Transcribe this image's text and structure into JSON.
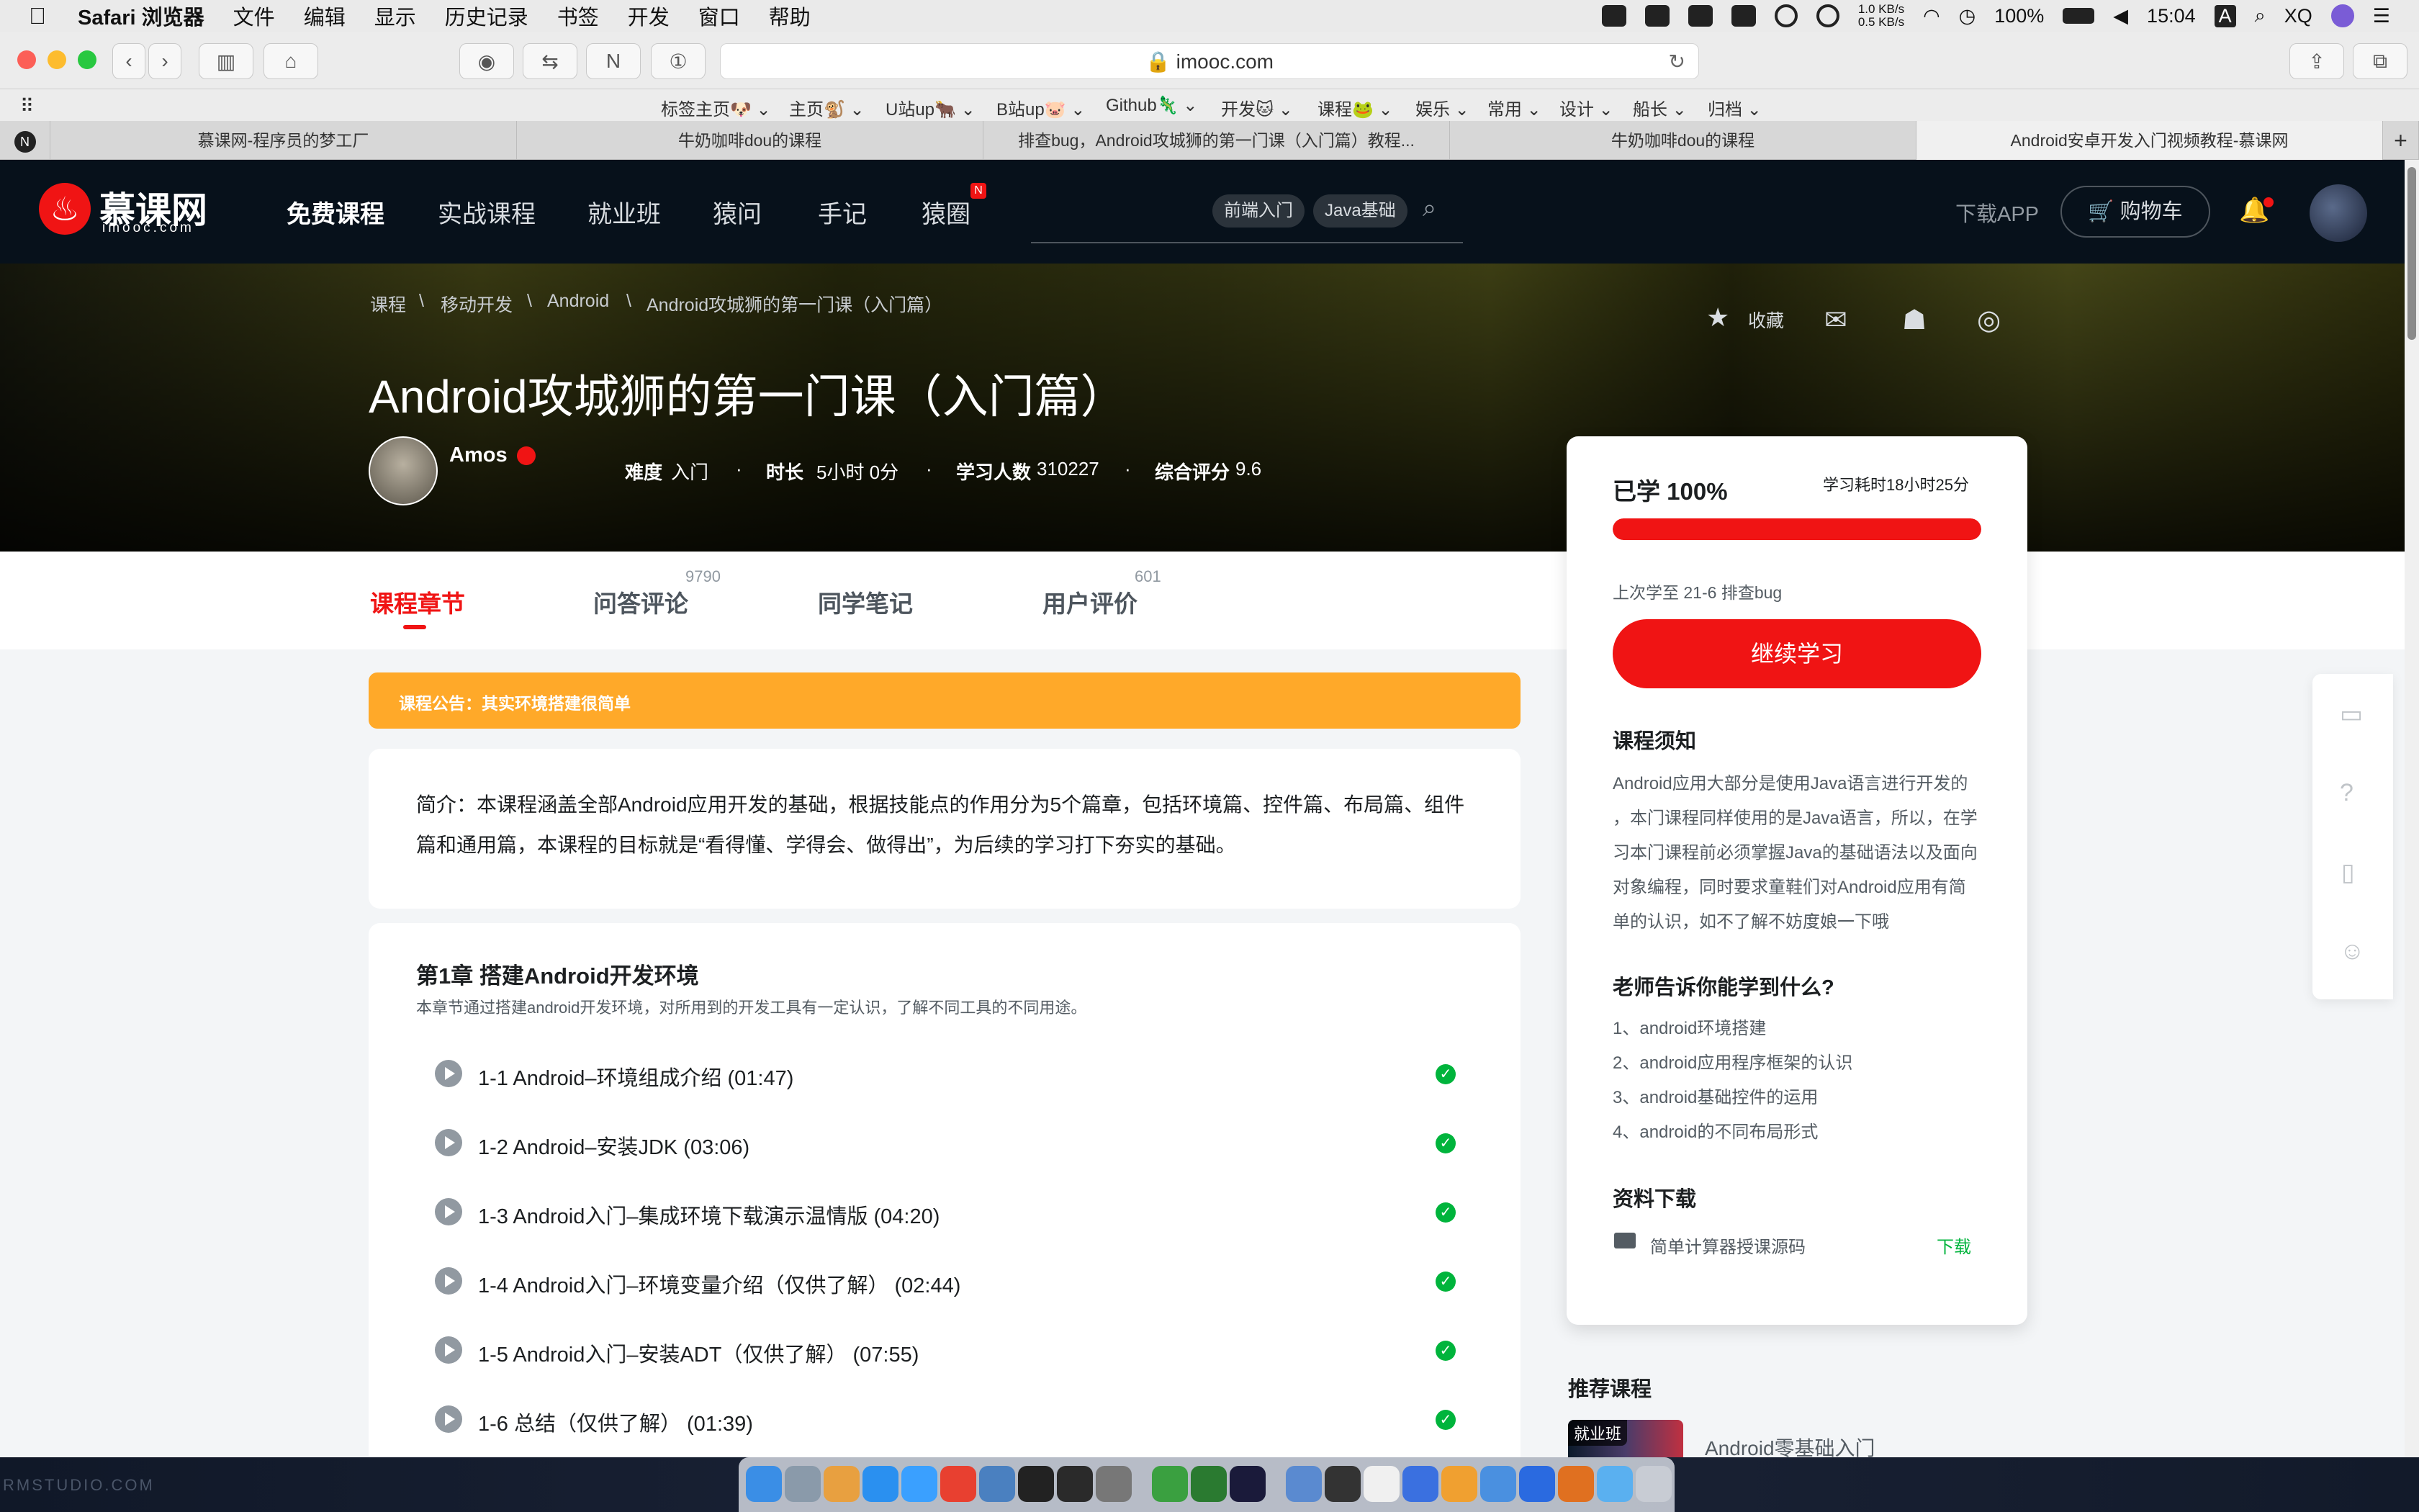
{
  "menubar": {
    "app": "Safari 浏览器",
    "items": [
      "文件",
      "编辑",
      "显示",
      "历史记录",
      "书签",
      "开发",
      "窗口",
      "帮助"
    ],
    "net_up": "1.0 KB/s",
    "net_down": "0.5 KB/s",
    "battery": "100%",
    "time": "15:04",
    "input": "A",
    "user": "XQ"
  },
  "browser": {
    "url": "imooc.com",
    "bookmarks": [
      "标签主页🐶",
      "主页🐒",
      "U站up🐂",
      "B站up🐷",
      "Github🦎",
      "开发🐱",
      "课程🐸",
      "娱乐",
      "常用",
      "设计",
      "船长",
      "归档"
    ],
    "tabs": [
      "慕课网-程序员的梦工厂",
      "牛奶咖啡dou的课程",
      "排查bug，Android攻城狮的第一门课（入门篇）教程...",
      "牛奶咖啡dou的课程",
      "Android安卓开发入门视频教程-慕课网"
    ]
  },
  "header": {
    "logo": "慕课网",
    "logo_sub": "imooc.com",
    "nav": [
      "免费课程",
      "实战课程",
      "就业班",
      "猿问",
      "手记",
      "猿圈"
    ],
    "nav_badge": "N",
    "search_tags": [
      "前端入门",
      "Java基础"
    ],
    "download": "下载APP",
    "cart": "购物车"
  },
  "course": {
    "breadcrumb": [
      "课程",
      "移动开发",
      "Android",
      "Android攻城狮的第一门课（入门篇）"
    ],
    "title": "Android攻城狮的第一门课（入门篇）",
    "teacher": "Amos",
    "meta": {
      "level_label": "难度",
      "level": "入门",
      "duration_label": "时长",
      "duration": "5小时 0分",
      "learners_label": "学习人数",
      "learners": "310227",
      "score_label": "综合评分",
      "score": "9.6"
    },
    "collect": "收藏",
    "tabs": [
      {
        "label": "课程章节"
      },
      {
        "label": "问答评论",
        "count": "9790"
      },
      {
        "label": "同学笔记"
      },
      {
        "label": "用户评价",
        "count": "601"
      }
    ],
    "notice": "课程公告：其实环境搭建很简单",
    "intro": "简介：本课程涵盖全部Android应用开发的基础，根据技能点的作用分为5个篇章，包括环境篇、控件篇、布局篇、组件篇和通用篇，本课程的目标就是“看得懂、学得会、做得出”，为后续的学习打下夯实的基础。",
    "chapter": {
      "title": "第1章 搭建Android开发环境",
      "desc": "本章节通过搭建android开发环境，对所用到的开发工具有一定认识，了解不同工具的不同用途。",
      "items": [
        "1-1 Android–环境组成介绍 (01:47)",
        "1-2 Android–安装JDK (03:06)",
        "1-3 Android入门–集成环境下载演示温情版 (04:20)",
        "1-4 Android入门–环境变量介绍（仅供了解） (02:44)",
        "1-5 Android入门–安装ADT（仅供了解） (07:55)",
        "1-6 总结（仅供了解） (01:39)"
      ]
    }
  },
  "progress": {
    "label": "已学 100%",
    "percent": 100,
    "time_spent": "学习耗时18小时25分",
    "last": "上次学至 21-6 排查bug",
    "continue": "继续学习"
  },
  "notes": {
    "title": "课程须知",
    "lines": [
      "Android应用大部分是使用Java语言进行开发的",
      "，本门课程同样使用的是Java语言，所以，在学",
      "习本门课程前必须掌握Java的基础语法以及面向",
      "对象编程，同时要求童鞋们对Android应用有简",
      "单的认识，如不了解不妨度娘一下哦"
    ]
  },
  "learn": {
    "title": "老师告诉你能学到什么?",
    "items": [
      "1、android环境搭建",
      "2、android应用程序框架的认识",
      "3、android基础控件的运用",
      "4、android的不同布局形式"
    ]
  },
  "resources": {
    "title": "资料下载",
    "items": [
      {
        "name": "简单计算器授课源码",
        "action": "下载"
      }
    ]
  },
  "recommend": {
    "title": "推荐课程",
    "badge": "就业班",
    "course": "Android零基础入门"
  },
  "watermark": "RMSTUDIO.COM",
  "colors": {
    "accent": "#f01414",
    "notice": "#ffa929",
    "success": "#00b43c",
    "header": "#07111b"
  }
}
